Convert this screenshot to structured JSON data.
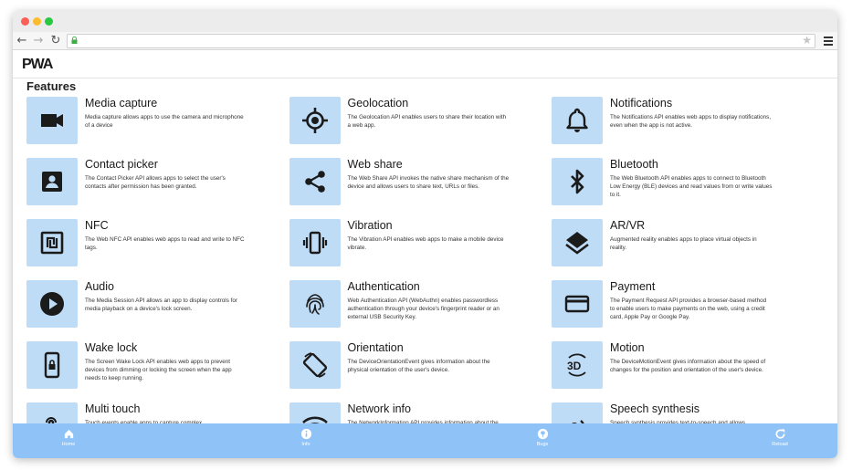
{
  "browser": {
    "address": ""
  },
  "app": {
    "logo_text": "PWA",
    "section_title": "Features"
  },
  "features": [
    {
      "title": "Media capture",
      "desc": "Media capture allows apps to use the camera and microphone of a device",
      "icon": "video-camera-icon"
    },
    {
      "title": "Geolocation",
      "desc": "The Geolocation API enables users to share their location with a web app.",
      "icon": "location-target-icon"
    },
    {
      "title": "Notifications",
      "desc": "The Notifications API enables web apps to display notifications, even when the app is not active.",
      "icon": "bell-icon"
    },
    {
      "title": "Contact picker",
      "desc": "The Contact Picker API allows apps to select the user's contacts after permission has been granted.",
      "icon": "contact-icon"
    },
    {
      "title": "Web share",
      "desc": "The Web Share API invokes the native share mechanism of the device and allows users to share text, URLs or files.",
      "icon": "share-icon"
    },
    {
      "title": "Bluetooth",
      "desc": "The Web Bluetooth API enables apps to connect to Bluetooth Low Energy (BLE) devices and read values from or write values to it.",
      "icon": "bluetooth-icon"
    },
    {
      "title": "NFC",
      "desc": "The Web NFC API enables web apps to read and write to NFC tags.",
      "icon": "nfc-icon"
    },
    {
      "title": "Vibration",
      "desc": "The Vibration API enables web apps to make a mobile device vibrate.",
      "icon": "vibration-icon"
    },
    {
      "title": "AR/VR",
      "desc": "Augmented reality enables apps to place virtual objects in reality.",
      "icon": "layers-icon"
    },
    {
      "title": "Audio",
      "desc": "The Media Session API allows an app to display controls for media playback on a device's lock screen.",
      "icon": "play-icon"
    },
    {
      "title": "Authentication",
      "desc": "Web Authentication API (WebAuthn) enables passwordless authentication through your device's fingerprint reader or an external USB Security Key.",
      "icon": "fingerprint-icon"
    },
    {
      "title": "Payment",
      "desc": "The Payment Request API provides a browser-based method to enable users to make payments on the web, using a credit card, Apple Pay or Google Pay.",
      "icon": "credit-card-icon"
    },
    {
      "title": "Wake lock",
      "desc": "The Screen Wake Lock API enables web apps to prevent devices from dimming or locking the screen when the app needs to keep running.",
      "icon": "phone-lock-icon"
    },
    {
      "title": "Orientation",
      "desc": "The DeviceOrientationEvent gives information about the physical orientation of the user's device.",
      "icon": "screen-rotation-icon"
    },
    {
      "title": "Motion",
      "desc": "The DeviceMotionEvent gives information about the speed of changes for the position and orientation of the user's device.",
      "icon": "3d-rotation-icon"
    },
    {
      "title": "Multi touch",
      "desc": "Touch events enable apps to capture complex",
      "icon": "touch-icon"
    },
    {
      "title": "Network info",
      "desc": "The NetworkInformation API provides information about the",
      "icon": "network-icon"
    },
    {
      "title": "Speech synthesis",
      "desc": "Speech synthesis provides text-to-speech and allows",
      "icon": "speaker-icon"
    }
  ],
  "bottom_nav": [
    {
      "label": "Home",
      "icon": "home-icon"
    },
    {
      "label": "Info",
      "icon": "info-icon"
    },
    {
      "label": "Bugs",
      "icon": "github-icon"
    },
    {
      "label": "Reload",
      "icon": "reload-icon"
    }
  ],
  "colors": {
    "icon_bg": "#bfdcf7",
    "bottom_nav_bg": "#8fc3f7",
    "lock_green": "#3cb043"
  }
}
